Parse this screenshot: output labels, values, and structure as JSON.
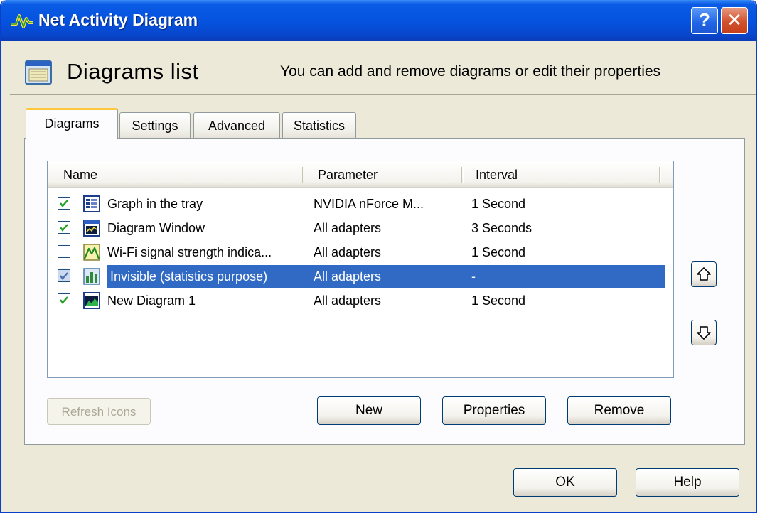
{
  "window": {
    "title": "Net Activity Diagram"
  },
  "titlebar": {
    "help_glyph": "?",
    "close_glyph": "✕"
  },
  "header": {
    "title": "Diagrams list",
    "description": "You can add and remove diagrams or edit their properties"
  },
  "tabs": [
    {
      "label": "Diagrams",
      "active": true
    },
    {
      "label": "Settings",
      "active": false
    },
    {
      "label": "Advanced",
      "active": false
    },
    {
      "label": "Statistics",
      "active": false
    }
  ],
  "list": {
    "columns": [
      "Name",
      "Parameter",
      "Interval"
    ],
    "rows": [
      {
        "name": "Graph in the tray",
        "parameter": "NVIDIA nForce M...",
        "interval": "1 Second",
        "checked": true,
        "icon": "tray-graph-icon",
        "selected": false
      },
      {
        "name": "Diagram Window",
        "parameter": "All adapters",
        "interval": "3 Seconds",
        "checked": true,
        "icon": "diagram-window-icon",
        "selected": false
      },
      {
        "name": "Wi-Fi signal strength indica...",
        "parameter": "All adapters",
        "interval": "1 Second",
        "checked": false,
        "icon": "wifi-signal-icon",
        "selected": false
      },
      {
        "name": "Invisible (statistics purpose)",
        "parameter": "All adapters",
        "interval": "-",
        "checked": true,
        "icon": "statistics-icon",
        "selected": true
      },
      {
        "name": "New Diagram 1",
        "parameter": "All adapters",
        "interval": "1 Second",
        "checked": true,
        "icon": "new-diagram-icon",
        "selected": false
      }
    ]
  },
  "buttons": {
    "refresh_icons": "Refresh Icons",
    "new": "New",
    "properties": "Properties",
    "remove": "Remove",
    "ok": "OK",
    "help": "Help"
  },
  "colors": {
    "titlebar": "#0553E0",
    "selection": "#316AC5",
    "dialog_bg": "#ECE9D8",
    "active_tab_accent": "#FFC83C"
  }
}
